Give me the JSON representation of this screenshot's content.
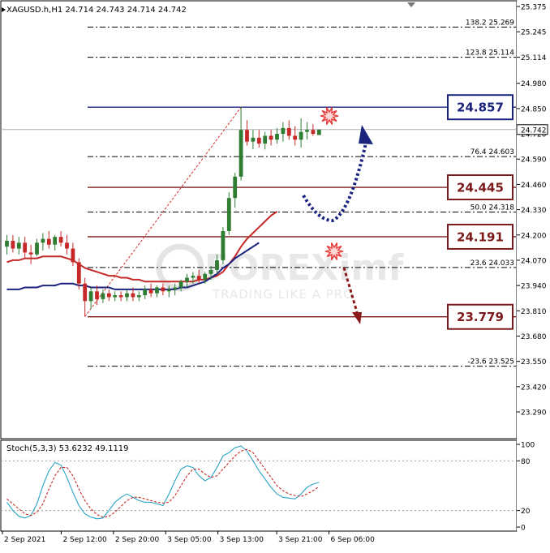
{
  "window_title": "XAGUSD.h,H1  24.714 24.743 24.714 24.742",
  "stoch_title": "Stoch(5,3,3) 53.6232 49.1119",
  "watermark": {
    "brand": "FOREXimf",
    "tagline": "TRADING LIKE A PRO"
  },
  "colors": {
    "bull": "#2e7d32",
    "bear": "#c62828",
    "ma_red": "#c62828",
    "ma_blue": "#1a237e",
    "resistance": "#1a237e",
    "support": "#7b1a1a",
    "stoch_main": "#29a3c7",
    "stoch_signal": "#c62828"
  },
  "chart_data": [
    {
      "type": "candlestick",
      "symbol": "XAGUSD.h",
      "timeframe": "H1",
      "ohlc_header": [
        24.714,
        24.743,
        24.714,
        24.742
      ],
      "ylim": [
        23.29,
        25.375
      ],
      "y_ticks": [
        "25.375",
        "25.245",
        "25.114",
        "24.980",
        "24.850",
        "24.720",
        "24.590",
        "24.460",
        "24.330",
        "24.200",
        "24.070",
        "23.940",
        "23.810",
        "23.680",
        "23.550",
        "23.420",
        "23.290"
      ],
      "x_labels": [
        "2 Sep 2021",
        "2 Sep 12:00",
        "2 Sep 20:00",
        "3 Sep 05:00",
        "3 Sep 13:00",
        "3 Sep 21:00",
        "6 Sep 06:00"
      ],
      "current_price": "24.742",
      "candles": [
        [
          24.14,
          24.2,
          24.1,
          24.17
        ],
        [
          24.17,
          24.2,
          24.11,
          24.13
        ],
        [
          24.13,
          24.19,
          24.1,
          24.16
        ],
        [
          24.16,
          24.19,
          24.08,
          24.11
        ],
        [
          24.11,
          24.15,
          24.05,
          24.1
        ],
        [
          24.1,
          24.18,
          24.09,
          24.16
        ],
        [
          24.16,
          24.21,
          24.12,
          24.18
        ],
        [
          24.18,
          24.22,
          24.13,
          24.15
        ],
        [
          24.15,
          24.2,
          24.12,
          24.19
        ],
        [
          24.19,
          24.22,
          24.14,
          24.16
        ],
        [
          24.16,
          24.2,
          24.1,
          24.13
        ],
        [
          24.13,
          24.16,
          24.04,
          24.06
        ],
        [
          24.06,
          24.08,
          23.92,
          23.95
        ],
        [
          23.95,
          23.98,
          23.78,
          23.86
        ],
        [
          23.86,
          23.93,
          23.82,
          23.91
        ],
        [
          23.91,
          23.94,
          23.84,
          23.87
        ],
        [
          23.87,
          23.92,
          23.85,
          23.9
        ],
        [
          23.9,
          23.92,
          23.86,
          23.88
        ],
        [
          23.88,
          23.91,
          23.86,
          23.89
        ],
        [
          23.89,
          23.91,
          23.86,
          23.88
        ],
        [
          23.88,
          23.92,
          23.86,
          23.9
        ],
        [
          23.9,
          23.93,
          23.86,
          23.88
        ],
        [
          23.88,
          23.91,
          23.86,
          23.89
        ],
        [
          23.89,
          23.94,
          23.87,
          23.92
        ],
        [
          23.92,
          23.95,
          23.88,
          23.9
        ],
        [
          23.9,
          23.94,
          23.88,
          23.93
        ],
        [
          23.93,
          23.95,
          23.89,
          23.91
        ],
        [
          23.91,
          23.94,
          23.88,
          23.92
        ],
        [
          23.92,
          23.95,
          23.89,
          23.93
        ],
        [
          23.93,
          23.97,
          23.91,
          23.96
        ],
        [
          23.96,
          24.0,
          23.93,
          23.98
        ],
        [
          23.98,
          24.01,
          23.95,
          23.99
        ],
        [
          23.99,
          24.02,
          23.95,
          23.97
        ],
        [
          23.97,
          24.01,
          23.95,
          24.0
        ],
        [
          24.0,
          24.04,
          23.97,
          24.02
        ],
        [
          24.02,
          24.1,
          24.0,
          24.07
        ],
        [
          24.07,
          24.24,
          24.05,
          24.22
        ],
        [
          24.22,
          24.42,
          24.2,
          24.39
        ],
        [
          24.39,
          24.52,
          24.34,
          24.5
        ],
        [
          24.5,
          24.86,
          24.48,
          24.74
        ],
        [
          24.74,
          24.79,
          24.66,
          24.68
        ],
        [
          24.68,
          24.74,
          24.64,
          24.7
        ],
        [
          24.7,
          24.74,
          24.65,
          24.67
        ],
        [
          24.67,
          24.73,
          24.64,
          24.71
        ],
        [
          24.71,
          24.74,
          24.66,
          24.69
        ],
        [
          24.69,
          24.75,
          24.67,
          24.72
        ],
        [
          24.72,
          24.78,
          24.68,
          24.75
        ],
        [
          24.75,
          24.79,
          24.69,
          24.71
        ],
        [
          24.71,
          24.76,
          24.66,
          24.69
        ],
        [
          24.69,
          24.8,
          24.65,
          24.73
        ],
        [
          24.73,
          24.78,
          24.69,
          24.74
        ],
        [
          24.74,
          24.77,
          24.71,
          24.72
        ],
        [
          24.714,
          24.743,
          24.714,
          24.742
        ]
      ],
      "ma_red": [
        24.06,
        24.07,
        24.07,
        24.08,
        24.08,
        24.08,
        24.09,
        24.09,
        24.09,
        24.09,
        24.08,
        24.07,
        24.05,
        24.03,
        24.02,
        24.01,
        24.0,
        23.99,
        23.99,
        23.98,
        23.98,
        23.97,
        23.97,
        23.96,
        23.96,
        23.96,
        23.96,
        23.96,
        23.96,
        23.96,
        23.96,
        23.96,
        23.97,
        23.97,
        23.98,
        23.99,
        24.01,
        24.05,
        24.09,
        24.14,
        24.18,
        24.21,
        24.24,
        24.27,
        24.3,
        24.32
      ],
      "ma_blue": [
        23.92,
        23.92,
        23.92,
        23.93,
        23.93,
        23.93,
        23.94,
        23.94,
        23.94,
        23.95,
        23.95,
        23.95,
        23.94,
        23.94,
        23.93,
        23.93,
        23.93,
        23.93,
        23.92,
        23.92,
        23.92,
        23.92,
        23.92,
        23.92,
        23.92,
        23.92,
        23.92,
        23.92,
        23.92,
        23.93,
        23.93,
        23.94,
        23.95,
        23.96,
        23.98,
        24.0,
        24.03,
        24.05,
        24.08,
        24.1,
        24.12,
        24.14,
        24.16
      ],
      "fib_levels": [
        {
          "ratio": "138.2",
          "value": "25.269"
        },
        {
          "ratio": "123.8",
          "value": "25.114"
        },
        {
          "ratio": "76.4",
          "value": "24.603"
        },
        {
          "ratio": "50.0",
          "value": "24.318"
        },
        {
          "ratio": "23.6",
          "value": "24.033"
        },
        {
          "ratio": "-23.6",
          "value": "23.525"
        }
      ],
      "key_levels": [
        {
          "label": "24.857",
          "kind": "resistance"
        },
        {
          "label": "24.445",
          "kind": "support"
        },
        {
          "label": "24.191",
          "kind": "support"
        },
        {
          "label": "23.779",
          "kind": "support"
        }
      ],
      "fib_swing": {
        "from": 23.78,
        "to": 24.857
      },
      "annotations": [
        "bullish path arrow",
        "bearish path arrow"
      ]
    },
    {
      "type": "line",
      "name": "Stoch(5,3,3)",
      "values_header": [
        53.6232,
        49.1119
      ],
      "ylim": [
        0,
        100
      ],
      "y_ticks": [
        "100",
        "80",
        "20",
        "0"
      ],
      "main": [
        30,
        20,
        13,
        11,
        14,
        28,
        50,
        68,
        78,
        75,
        60,
        42,
        26,
        16,
        12,
        10,
        11,
        20,
        30,
        36,
        40,
        36,
        32,
        30,
        30,
        28,
        26,
        40,
        56,
        70,
        74,
        72,
        62,
        56,
        60,
        72,
        86,
        90,
        96,
        98,
        92,
        80,
        68,
        58,
        48,
        40,
        36,
        35,
        34,
        40,
        48,
        52,
        54
      ],
      "signal": [
        34,
        28,
        22,
        16,
        14,
        18,
        28,
        46,
        62,
        72,
        72,
        62,
        46,
        32,
        22,
        15,
        12,
        13,
        18,
        25,
        32,
        36,
        36,
        34,
        32,
        30,
        29,
        30,
        38,
        50,
        62,
        70,
        70,
        64,
        60,
        62,
        70,
        78,
        86,
        92,
        94,
        90,
        80,
        70,
        60,
        50,
        44,
        40,
        38,
        37,
        40,
        44,
        49
      ]
    }
  ]
}
